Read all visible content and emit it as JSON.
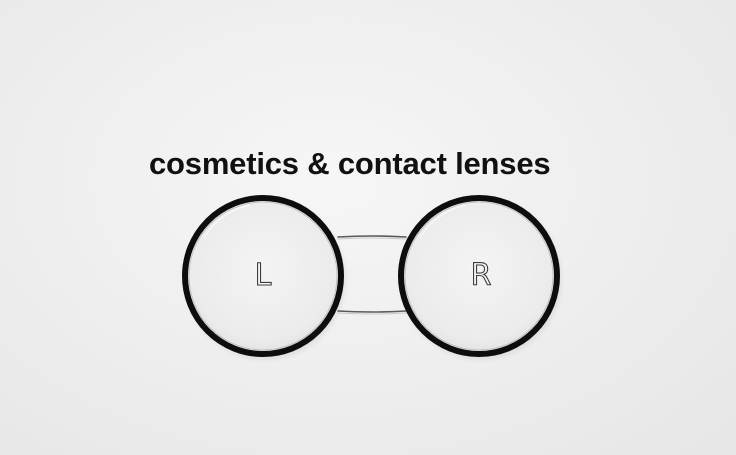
{
  "headline": "cosmetics & contact lenses",
  "lens_case": {
    "left_label": "L",
    "right_label": "R"
  },
  "colors": {
    "background": "#efefef",
    "ring": "#111111",
    "text": "#111111"
  }
}
